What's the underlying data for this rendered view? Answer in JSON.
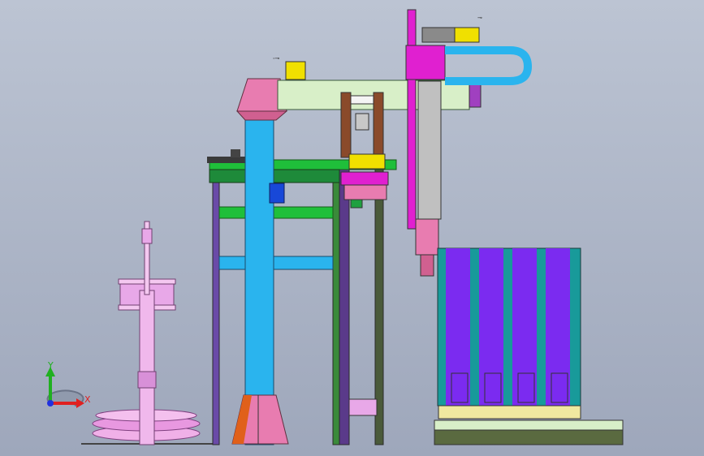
{
  "viewport": {
    "background_top": "#bcc4d3",
    "background_bottom": "#9ea7bb"
  },
  "triad": {
    "x_label": "X",
    "y_label": "Y",
    "x_color": "#e02020",
    "y_color": "#20b020",
    "z_color": "#2030e0"
  },
  "palette": {
    "cyan": "#2ab4ee",
    "green": "#1fbf3a",
    "magenta": "#e020d0",
    "pink": "#e87cb0",
    "light_pink": "#e8a8e8",
    "purple": "#7b2bf0",
    "teal": "#189a9a",
    "yellow": "#f0e000",
    "pale_green": "#d8efc8",
    "olive": "#5a6a40",
    "orange": "#e0601a"
  }
}
